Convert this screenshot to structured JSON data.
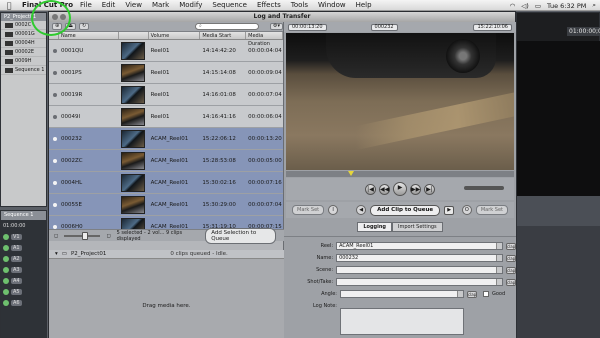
{
  "menubar": {
    "apple": "",
    "app_name": "Final Cut Pro",
    "menus": [
      "File",
      "Edit",
      "View",
      "Mark",
      "Modify",
      "Sequence",
      "Effects",
      "Tools",
      "Window",
      "Help"
    ],
    "status_clock": "Tue 6:32 PM"
  },
  "window": {
    "title": "Log and Transfer"
  },
  "browser": {
    "title": "P2_Project01",
    "items": [
      "0002C",
      "00001G",
      "00004H",
      "00002E",
      "0009H",
      "Sequence 1"
    ]
  },
  "timeline": {
    "tab": "Sequence 1",
    "timecode": "01:00:00",
    "tracks": [
      "V1",
      "A1",
      "A2",
      "A3",
      "A4",
      "A5",
      "A6"
    ]
  },
  "viewer_bg": {
    "timecode": "01:00:00;00"
  },
  "clip_list": {
    "columns": [
      "",
      "Name",
      "Volume",
      "Media Start",
      "Media Duration"
    ],
    "search_placeholder": "",
    "rows": [
      {
        "name": "0001QU",
        "volume": "Reel01",
        "media_start": "14:14:42:20",
        "media_duration": "00:00:04:04",
        "selected": false
      },
      {
        "name": "0001PS",
        "volume": "Reel01",
        "media_start": "14:15:14:08",
        "media_duration": "00:00:09:04",
        "selected": false
      },
      {
        "name": "00019R",
        "volume": "Reel01",
        "media_start": "14:16:01:08",
        "media_duration": "00:00:07:04",
        "selected": false
      },
      {
        "name": "00049I",
        "volume": "Reel01",
        "media_start": "14:16:41:16",
        "media_duration": "00:00:06:04",
        "selected": false
      },
      {
        "name": "000232",
        "volume": "ACAM_Reel01",
        "media_start": "15:22:06:12",
        "media_duration": "00:00:13:20",
        "selected": true
      },
      {
        "name": "0002ZC",
        "volume": "ACAM_Reel01",
        "media_start": "15:28:53:08",
        "media_duration": "00:00:05:00",
        "selected": true
      },
      {
        "name": "0004HL",
        "volume": "ACAM_Reel01",
        "media_start": "15:30:02:16",
        "media_duration": "00:00:07:16",
        "selected": true
      },
      {
        "name": "00055E",
        "volume": "ACAM_Reel01",
        "media_start": "15:30:29:00",
        "media_duration": "00:00:07:04",
        "selected": true
      },
      {
        "name": "0006H0",
        "volume": "ACAM_Reel01",
        "media_start": "15:31:19:10",
        "media_duration": "00:00:07:15",
        "selected": true
      }
    ],
    "status_text": "5 selected - 2 vol... 9 clips displayed",
    "add_selection_label": "Add Selection to Queue"
  },
  "queue": {
    "project": "P2_Project01",
    "count_text": "0 clips queued - Idle.",
    "drag_text": "Drag media here."
  },
  "preview": {
    "duration_tc": "00:00:13:20",
    "clip_name": "000232",
    "current_tc": "15:22:10:06",
    "mark_in_label": "Mark Set",
    "mark_out_label": "Mark Set",
    "in_btn": "I",
    "out_btn": "O",
    "add_clip_label": "Add Clip to Queue",
    "prev_btn": "◀",
    "next_btn": "▶"
  },
  "transport": {
    "buttons": [
      "|◀",
      "◀◀",
      "▶",
      "▶▶",
      "▶|"
    ]
  },
  "tabs": [
    "Logging",
    "Import Settings"
  ],
  "logging": {
    "reel_label": "Reel:",
    "reel_value": "ACAM_Reel01",
    "name_label": "Name:",
    "name_value": "000232",
    "scene_label": "Scene:",
    "scene_value": "",
    "shot_label": "Shot/Take:",
    "shot_value": "",
    "angle_label": "Angle:",
    "angle_value": "",
    "good_label": "Good",
    "lognote_label": "Log Note:",
    "lognote_value": "",
    "clap_label": "clap"
  }
}
